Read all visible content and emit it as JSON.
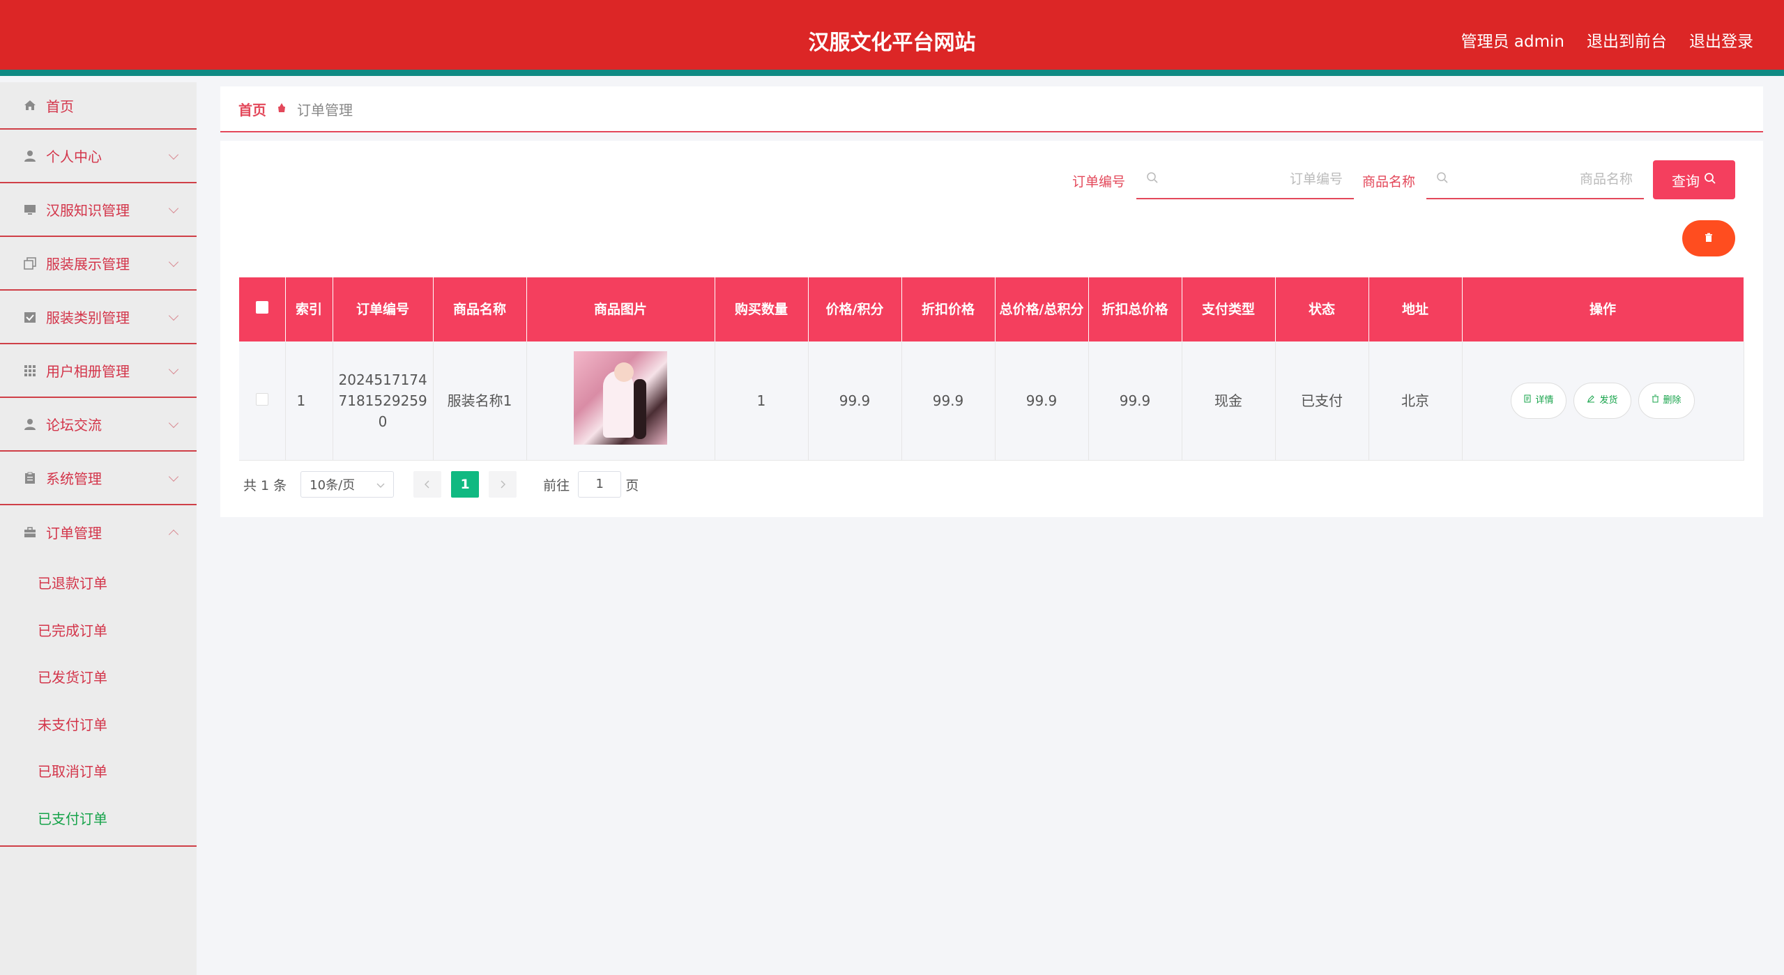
{
  "header": {
    "title": "汉服文化平台网站",
    "links": [
      "管理员 admin",
      "退出到前台",
      "退出登录"
    ]
  },
  "sidebar": {
    "items": [
      {
        "label": "首页",
        "icon": "home-icon"
      },
      {
        "label": "个人中心",
        "icon": "user-icon"
      },
      {
        "label": "汉服知识管理",
        "icon": "monitor-icon"
      },
      {
        "label": "服装展示管理",
        "icon": "copy-icon"
      },
      {
        "label": "服装类别管理",
        "icon": "checkbox-icon"
      },
      {
        "label": "用户相册管理",
        "icon": "grid-icon"
      },
      {
        "label": "论坛交流",
        "icon": "user-icon"
      },
      {
        "label": "系统管理",
        "icon": "clipboard-icon"
      },
      {
        "label": "订单管理",
        "icon": "briefcase-icon"
      }
    ],
    "order_submenu": [
      "已退款订单",
      "已完成订单",
      "已发货订单",
      "未支付订单",
      "已取消订单",
      "已支付订单"
    ],
    "active_sub": "已支付订单"
  },
  "breadcrumb": {
    "home": "首页",
    "current": "订单管理"
  },
  "search": {
    "order_label": "订单编号",
    "order_placeholder": "订单编号",
    "product_label": "商品名称",
    "product_placeholder": "商品名称",
    "query_button": "查询"
  },
  "table": {
    "headers": [
      "索引",
      "订单编号",
      "商品名称",
      "商品图片",
      "购买数量",
      "价格/积分",
      "折扣价格",
      "总价格/总积分",
      "折扣总价格",
      "支付类型",
      "状态",
      "地址",
      "操作"
    ],
    "rows": [
      {
        "index": "1",
        "order_no": "20245171747181529259 0",
        "order_no_lines": [
          "2024517174",
          "7181529259",
          "0"
        ],
        "product_name": "服装名称1",
        "quantity": "1",
        "price": "99.9",
        "discount_price": "99.9",
        "total_price": "99.9",
        "discount_total": "99.9",
        "pay_type": "现金",
        "status": "已支付",
        "address": "北京"
      }
    ],
    "actions": [
      "详情",
      "发货",
      "删除"
    ]
  },
  "pagination": {
    "total": "共 1 条",
    "page_size": "10条/页",
    "current_page": "1",
    "goto_label": "前往",
    "goto_value": "1",
    "page_unit": "页"
  },
  "colors": {
    "header_bg": "#dc2626",
    "header_stripe": "#0f8a84",
    "accent": "#f43f5e",
    "active_green": "#16a34a",
    "page_green": "#10b981"
  }
}
